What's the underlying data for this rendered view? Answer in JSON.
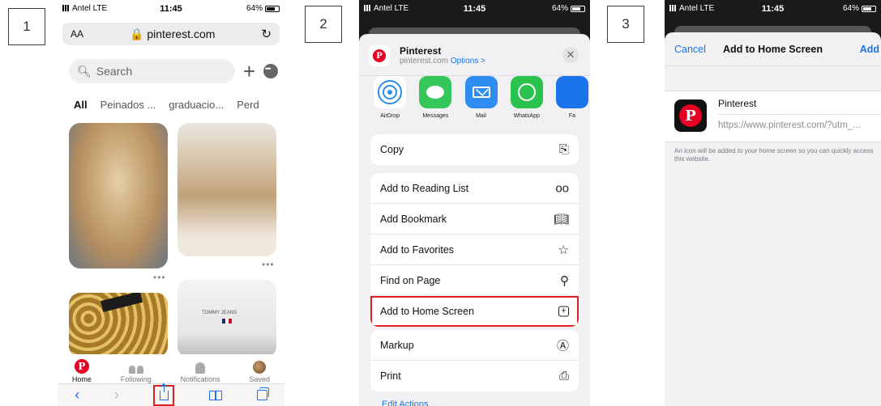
{
  "steps": [
    "1",
    "2",
    "3"
  ],
  "status": {
    "carrier": "Antel  LTE",
    "time": "11:45",
    "battery": "64%"
  },
  "phone1": {
    "aa": "AA",
    "url": "pinterest.com",
    "search_placeholder": "Search",
    "tabs": [
      "All",
      "Peinados ...",
      "graduacio...",
      "Perd"
    ],
    "pin_text": "TOMMY JEANS",
    "nav": [
      "Home",
      "Following",
      "Notifications",
      "Saved"
    ]
  },
  "phone2": {
    "title": "Pinterest",
    "domain": "pinterest.com",
    "options": "Options >",
    "apps": [
      "AirDrop",
      "Messages",
      "Mail",
      "WhatsApp",
      "Fa"
    ],
    "group1": [
      "Copy"
    ],
    "group2": [
      "Add to Reading List",
      "Add Bookmark",
      "Add to Favorites",
      "Find on Page",
      "Add to Home Screen"
    ],
    "group3": [
      "Markup",
      "Print"
    ],
    "edit_actions": "Edit Actions..."
  },
  "phone3": {
    "cancel": "Cancel",
    "title": "Add to Home Screen",
    "add": "Add",
    "app_name": "Pinterest",
    "url": "https://www.pinterest.com/?utm_...",
    "note": "An icon will be added to your home screen so you can quickly access this website."
  },
  "colors": {
    "accent": "#1a73e8",
    "highlight": "#e02020",
    "pinterest": "#e60023"
  }
}
